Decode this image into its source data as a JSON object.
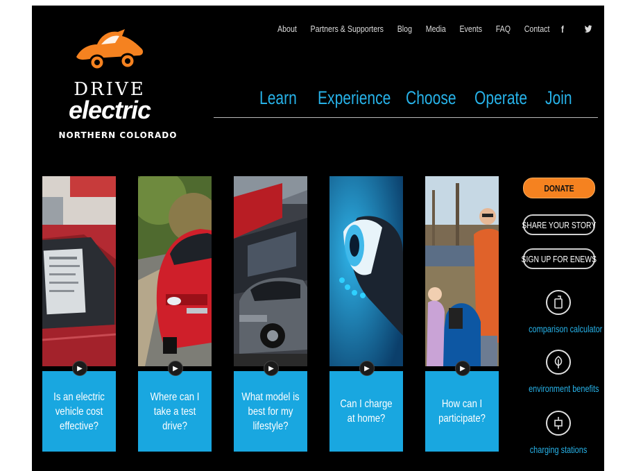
{
  "brand": {
    "line1": "DRIVE",
    "line2": "electric",
    "line3": "NORTHERN COLORADO",
    "accent": "#f58220"
  },
  "top_nav": [
    "About",
    "Partners & Supporters",
    "Blog",
    "Media",
    "Events",
    "FAQ",
    "Contact"
  ],
  "social_icons": [
    "facebook-icon",
    "twitter-icon",
    "linkedin-icon"
  ],
  "main_nav": [
    "Learn",
    "Experience",
    "Choose",
    "Operate",
    "Join"
  ],
  "tiles": [
    {
      "caption": "Is an electric vehicle cost effective?",
      "photo": "red car window sticker"
    },
    {
      "caption": "Where can I take a test drive?",
      "photo": "red car on road"
    },
    {
      "caption": "What model is best for my lifestyle?",
      "photo": "car at dealership"
    },
    {
      "caption": "Can I charge at home?",
      "photo": "charging plug"
    },
    {
      "caption": "How can I participate?",
      "photo": "family charging car"
    }
  ],
  "sidebar": {
    "donate": "DONATE",
    "share": "SHARE YOUR STORY",
    "signup": "SIGN UP FOR ENEWS",
    "tools": [
      {
        "label": "comparison calculator",
        "icon": "calculator-icon"
      },
      {
        "label": "environment benefits",
        "icon": "leaf-icon"
      },
      {
        "label": "charging stations",
        "icon": "plug-icon"
      }
    ]
  },
  "colors": {
    "blue": "#19a7e0",
    "nav_blue": "#27b2e8",
    "orange": "#f58220",
    "background": "#000000"
  }
}
